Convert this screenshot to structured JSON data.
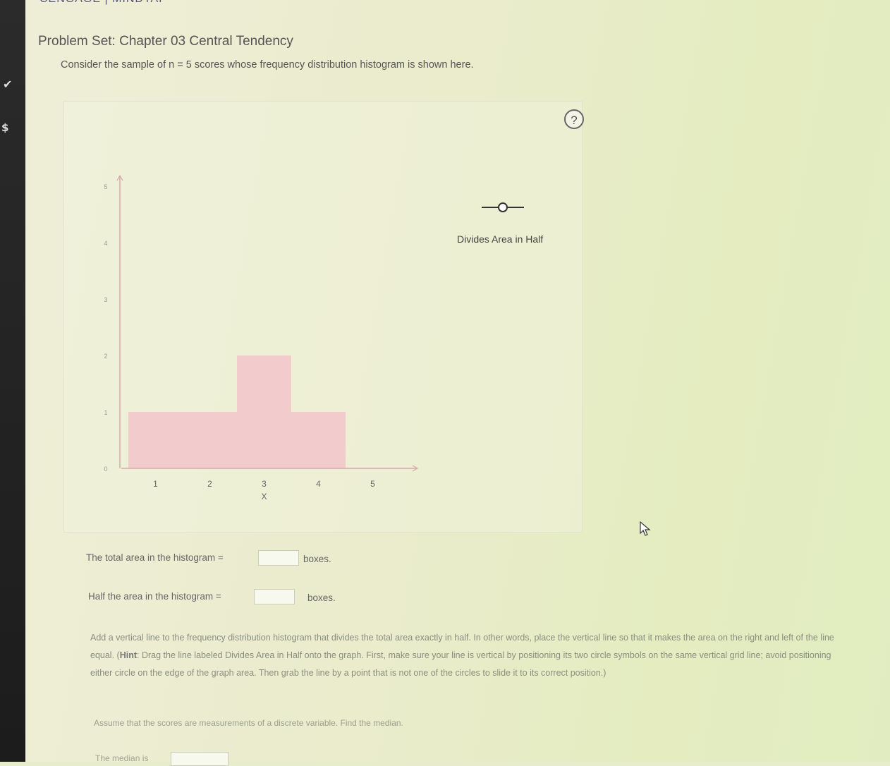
{
  "app": {
    "brand": "CENGAGE | MINDTAP"
  },
  "header": {
    "title": "Problem Set: Chapter 03 Central Tendency",
    "subtitle": "Consider the sample of n = 5 scores whose frequency distribution histogram is shown here."
  },
  "graph": {
    "help_label": "?",
    "legend_label": "Divides Area in Half"
  },
  "chart_data": {
    "type": "bar",
    "xlabel": "X",
    "ylabel": "",
    "x_ticks": [
      "1",
      "2",
      "3",
      "4",
      "5"
    ],
    "y_ticks": [
      "0",
      "1",
      "2",
      "3",
      "4",
      "5"
    ],
    "xlim": [
      0.5,
      5.5
    ],
    "ylim": [
      0,
      5
    ],
    "bars": [
      {
        "x": 1,
        "value": 1
      },
      {
        "x": 2,
        "value": 1
      },
      {
        "x": 3,
        "value": 2
      },
      {
        "x": 4,
        "value": 1
      }
    ],
    "bar_color": "#f2cccc"
  },
  "questions": {
    "total_area_label": "The total area in the histogram =",
    "total_area_value": "",
    "half_area_label": "Half the area in the histogram =",
    "half_area_value": "",
    "unit": "boxes."
  },
  "instructions": {
    "part1": "Add a vertical line to the frequency distribution histogram that divides the total area exactly in half. In other words, place the vertical line so that it makes the area on the right and left of the line equal. (",
    "hint_label": "Hint",
    "part2": ": Drag the line labeled Divides Area in Half onto the graph. First, make sure your line is vertical by positioning its two circle symbols on the same vertical grid line; avoid positioning either circle on the edge of the graph area. Then grab the line by a point that is not one of the circles to slide it to its correct position.)"
  },
  "assume_text": "Assume that the scores are measurements of a discrete variable. Find the median.",
  "median": {
    "label": "The median is",
    "value": ""
  }
}
